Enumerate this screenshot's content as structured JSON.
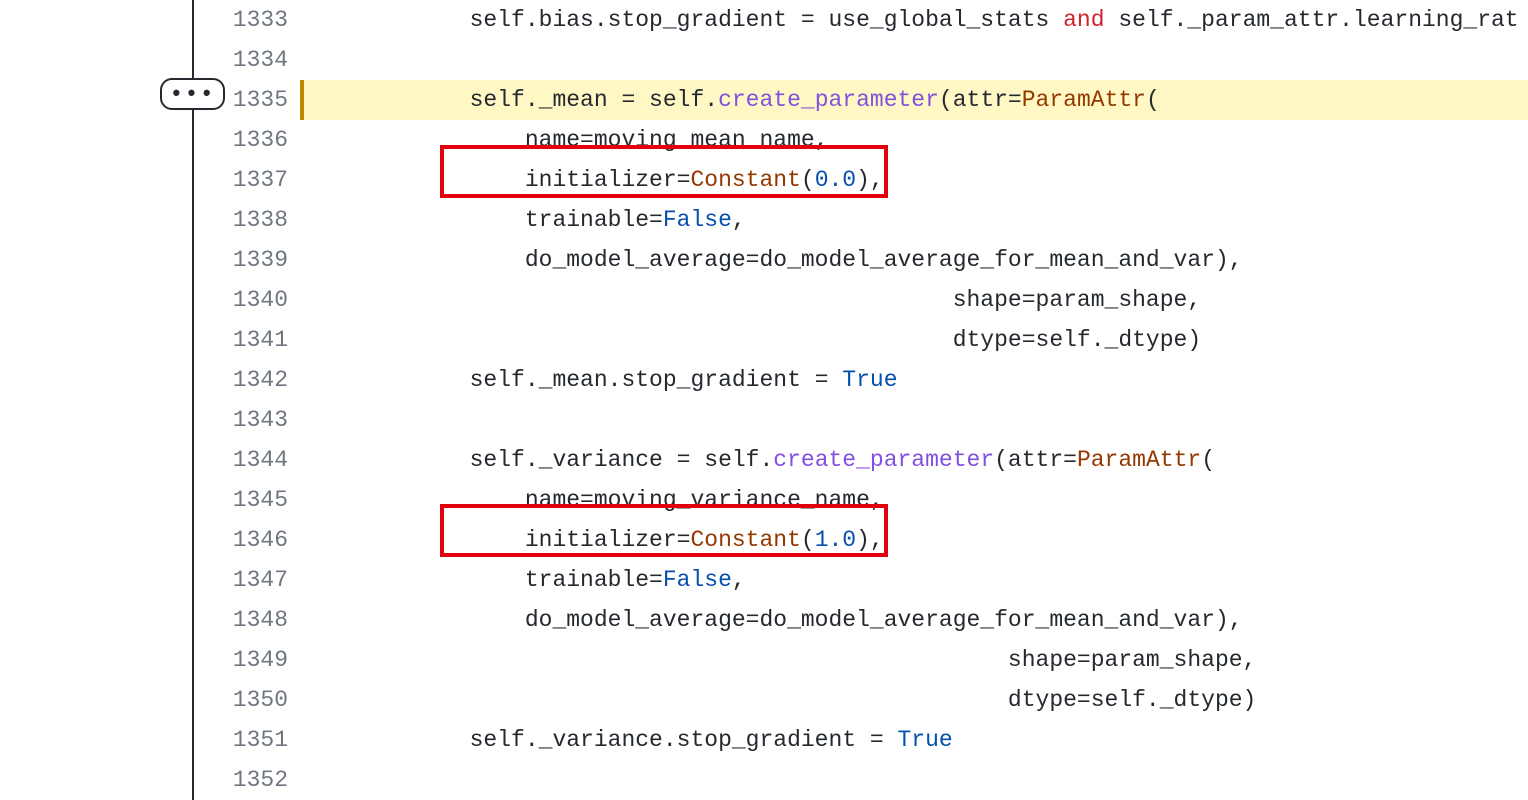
{
  "ellipsis": "•••",
  "lines": [
    {
      "num": "1333",
      "hl": false,
      "tokens": [
        {
          "t": "            self.bias.stop_gradient = use_global_stats "
        },
        {
          "t": "and",
          "c": "tk-kw"
        },
        {
          "t": " self._param_attr.learning_rat"
        }
      ]
    },
    {
      "num": "1334",
      "hl": false,
      "tokens": [
        {
          "t": ""
        }
      ]
    },
    {
      "num": "1335",
      "hl": true,
      "tokens": [
        {
          "t": "            self._mean = self."
        },
        {
          "t": "create_parameter",
          "c": "tk-fn"
        },
        {
          "t": "(attr="
        },
        {
          "t": "ParamAttr",
          "c": "tk-cls"
        },
        {
          "t": "("
        }
      ]
    },
    {
      "num": "1336",
      "hl": false,
      "tokens": [
        {
          "t": "                name=moving_mean_name,"
        }
      ]
    },
    {
      "num": "1337",
      "hl": false,
      "tokens": [
        {
          "t": "                initializer="
        },
        {
          "t": "Constant",
          "c": "tk-cls"
        },
        {
          "t": "("
        },
        {
          "t": "0.0",
          "c": "tk-num"
        },
        {
          "t": "),"
        }
      ]
    },
    {
      "num": "1338",
      "hl": false,
      "tokens": [
        {
          "t": "                trainable="
        },
        {
          "t": "False",
          "c": "tk-const"
        },
        {
          "t": ","
        }
      ]
    },
    {
      "num": "1339",
      "hl": false,
      "tokens": [
        {
          "t": "                do_model_average=do_model_average_for_mean_and_var),"
        }
      ]
    },
    {
      "num": "1340",
      "hl": false,
      "tokens": [
        {
          "t": "                                               shape=param_shape,"
        }
      ]
    },
    {
      "num": "1341",
      "hl": false,
      "tokens": [
        {
          "t": "                                               dtype=self._dtype)"
        }
      ]
    },
    {
      "num": "1342",
      "hl": false,
      "tokens": [
        {
          "t": "            self._mean.stop_gradient = "
        },
        {
          "t": "True",
          "c": "tk-const"
        }
      ]
    },
    {
      "num": "1343",
      "hl": false,
      "tokens": [
        {
          "t": ""
        }
      ]
    },
    {
      "num": "1344",
      "hl": false,
      "tokens": [
        {
          "t": "            self._variance = self."
        },
        {
          "t": "create_parameter",
          "c": "tk-fn"
        },
        {
          "t": "(attr="
        },
        {
          "t": "ParamAttr",
          "c": "tk-cls"
        },
        {
          "t": "("
        }
      ]
    },
    {
      "num": "1345",
      "hl": false,
      "tokens": [
        {
          "t": "                name=moving_variance_name,"
        }
      ]
    },
    {
      "num": "1346",
      "hl": false,
      "tokens": [
        {
          "t": "                initializer="
        },
        {
          "t": "Constant",
          "c": "tk-cls"
        },
        {
          "t": "("
        },
        {
          "t": "1.0",
          "c": "tk-num"
        },
        {
          "t": "),"
        }
      ]
    },
    {
      "num": "1347",
      "hl": false,
      "tokens": [
        {
          "t": "                trainable="
        },
        {
          "t": "False",
          "c": "tk-const"
        },
        {
          "t": ","
        }
      ]
    },
    {
      "num": "1348",
      "hl": false,
      "tokens": [
        {
          "t": "                do_model_average=do_model_average_for_mean_and_var),"
        }
      ]
    },
    {
      "num": "1349",
      "hl": false,
      "tokens": [
        {
          "t": "                                                   shape=param_shape,"
        }
      ]
    },
    {
      "num": "1350",
      "hl": false,
      "tokens": [
        {
          "t": "                                                   dtype=self._dtype)"
        }
      ]
    },
    {
      "num": "1351",
      "hl": false,
      "tokens": [
        {
          "t": "            self._variance.stop_gradient = "
        },
        {
          "t": "True",
          "c": "tk-const"
        }
      ]
    },
    {
      "num": "1352",
      "hl": false,
      "tokens": [
        {
          "t": ""
        }
      ]
    }
  ]
}
